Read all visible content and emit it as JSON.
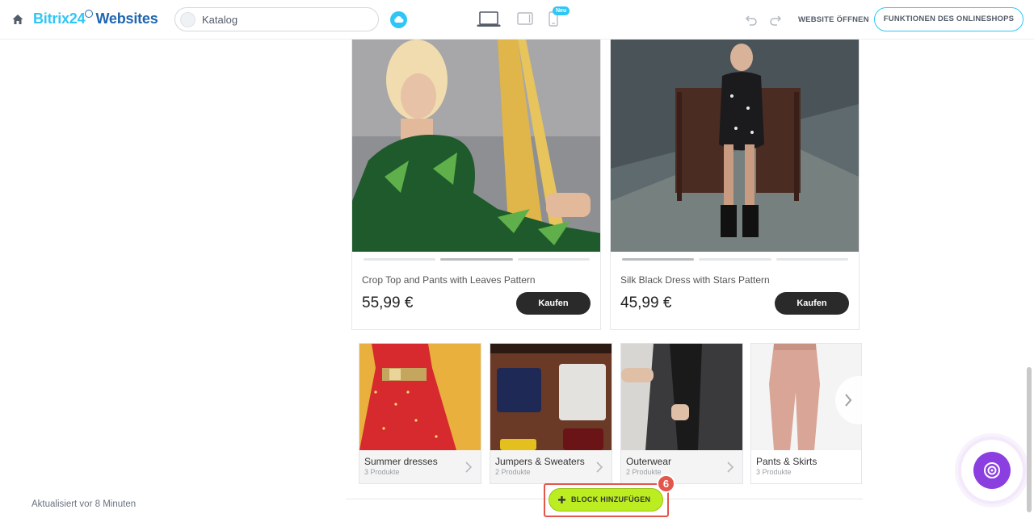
{
  "topbar": {
    "brand_part1": "Bitrix24",
    "brand_part2": "Websites",
    "page_select_value": "Katalog",
    "new_badge": "Neu",
    "open_website": "WEBSITE ÖFFNEN",
    "shop_features": "FUNKTIONEN DES ONLINESHOPS"
  },
  "products": [
    {
      "name": "Crop Top and Pants with Leaves Pattern",
      "price": "55,99 €",
      "buy_label": "Kaufen"
    },
    {
      "name": "Silk Black Dress with Stars Pattern",
      "price": "45,99 €",
      "buy_label": "Kaufen"
    }
  ],
  "categories": [
    {
      "name": "Summer dresses",
      "count": "3 Produkte"
    },
    {
      "name": "Jumpers & Sweaters",
      "count": "2 Produkte"
    },
    {
      "name": "Outerwear",
      "count": "2 Produkte"
    },
    {
      "name": "Pants & Skirts",
      "count": "3 Produkte"
    }
  ],
  "footer": {
    "updated": "Aktualisiert vor 8 Minuten",
    "add_block": "BLOCK HINZUFÜGEN",
    "step_number": "6"
  },
  "colors": {
    "brand_light": "#2fc6f6",
    "brand_dark": "#2066b0",
    "add_button": "#bbed21",
    "highlight": "#e2564b",
    "assistant": "#8b3fe0"
  }
}
